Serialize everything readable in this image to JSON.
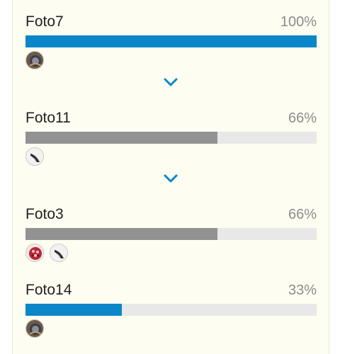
{
  "poll": {
    "colors": {
      "winner_bar": "#0a86c9",
      "other_bar": "#929292",
      "track": "#e8e8e8",
      "background": "#fdfdf1",
      "chevron": "#0a86c9"
    },
    "options": [
      {
        "label": "Foto7",
        "percent_text": "100%",
        "percent": 100,
        "winner": true,
        "voters": [
          "avatar-dark-round"
        ]
      },
      {
        "label": "Foto11",
        "percent_text": "66%",
        "percent": 66,
        "winner": false,
        "voters": [
          "avatar-sketch"
        ]
      },
      {
        "label": "Foto3",
        "percent_text": "66%",
        "percent": 66,
        "winner": false,
        "voters": [
          "avatar-red-pattern",
          "avatar-sketch"
        ]
      },
      {
        "label": "Foto14",
        "percent_text": "33%",
        "percent": 33,
        "winner": true,
        "voters": [
          "avatar-dark-round"
        ]
      }
    ],
    "expand_icons": [
      "chevron-down-icon",
      "chevron-down-icon"
    ]
  }
}
